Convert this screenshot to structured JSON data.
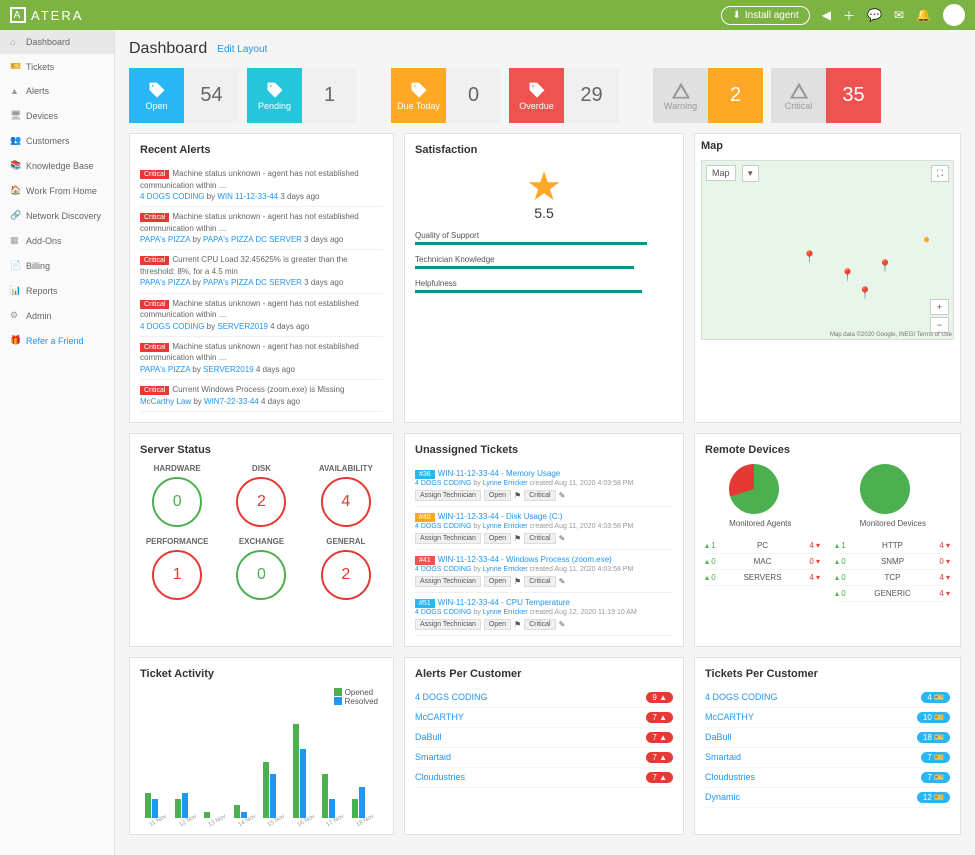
{
  "brand": "ATERA",
  "install_label": "Install agent",
  "nav": [
    {
      "icon": "⌂",
      "label": "Dashboard",
      "active": true
    },
    {
      "icon": "🎫",
      "label": "Tickets"
    },
    {
      "icon": "▲",
      "label": "Alerts"
    },
    {
      "icon": "🖥",
      "label": "Devices"
    },
    {
      "icon": "👥",
      "label": "Customers"
    },
    {
      "icon": "📚",
      "label": "Knowledge Base"
    },
    {
      "icon": "🏠",
      "label": "Work From Home"
    },
    {
      "icon": "🔗",
      "label": "Network Discovery"
    },
    {
      "icon": "▦",
      "label": "Add-Ons"
    },
    {
      "icon": "📄",
      "label": "Billing"
    },
    {
      "icon": "📊",
      "label": "Reports"
    },
    {
      "icon": "⚙",
      "label": "Admin"
    }
  ],
  "refer_label": "Refer a Friend",
  "page_title": "Dashboard",
  "edit_layout": "Edit Layout",
  "stats": [
    {
      "label": "Open",
      "value": "54",
      "color": "c-blue"
    },
    {
      "label": "Pending",
      "value": "1",
      "color": "c-cyan"
    },
    {
      "label": "Due Today",
      "value": "0",
      "color": "c-orange"
    },
    {
      "label": "Overdue",
      "value": "29",
      "color": "c-red"
    },
    {
      "label": "Warning",
      "value": "2",
      "color": "c-orange",
      "icon": "warn",
      "iconbg": "c-gray"
    },
    {
      "label": "Critical",
      "value": "35",
      "color": "c-red",
      "icon": "warn",
      "iconbg": "c-gray"
    }
  ],
  "recent_alerts": {
    "title": "Recent Alerts",
    "items": [
      {
        "sev": "Critical",
        "msg": "Machine status unknown - agent has not established communication within …",
        "cust": "4 DOGS CODING",
        "dev": "WIN 11-12-33-44",
        "age": "3 days ago"
      },
      {
        "sev": "Critical",
        "msg": "Machine status unknown - agent has not established communication within …",
        "cust": "PAPA's PIZZA",
        "dev": "PAPA's PIZZA DC SERVER",
        "age": "3 days ago"
      },
      {
        "sev": "Critical",
        "msg": "Current CPU Load 32.45625% is greater than the threshold: 8%, for a 4.5 min",
        "cust": "PAPA's PIZZA",
        "dev": "PAPA's PIZZA DC SERVER",
        "age": "3 days ago"
      },
      {
        "sev": "Critical",
        "msg": "Machine status unknown - agent has not established communication within …",
        "cust": "4 DOGS CODING",
        "dev": "SERVER2019",
        "age": "4 days ago"
      },
      {
        "sev": "Critical",
        "msg": "Machine status unknown - agent has not established communication within …",
        "cust": "PAPA's PIZZA",
        "dev": "SERVER2019",
        "age": "4 days ago"
      },
      {
        "sev": "Critical",
        "msg": "Current Windows Process (zoom.exe) is Missing",
        "cust": "McCarthy Law",
        "dev": "WIN7-22-33-44",
        "age": "4 days ago"
      }
    ]
  },
  "satisfaction": {
    "title": "Satisfaction",
    "score": "5.5",
    "metrics": [
      {
        "label": "Quality of Support",
        "pct": 90
      },
      {
        "label": "Technician Knowledge",
        "pct": 85
      },
      {
        "label": "Helpfulness",
        "pct": 88
      }
    ]
  },
  "map": {
    "title": "Map",
    "type_label": "Map",
    "attrib": "Map data ©2020 Google, INEGI    Terms of Use"
  },
  "server_status": {
    "title": "Server Status",
    "items": [
      {
        "label": "HARDWARE",
        "val": "0",
        "cls": "g-green"
      },
      {
        "label": "DISK",
        "val": "2",
        "cls": "g-red"
      },
      {
        "label": "AVAILABILITY",
        "val": "4",
        "cls": "g-red"
      },
      {
        "label": "PERFORMANCE",
        "val": "1",
        "cls": "g-red"
      },
      {
        "label": "EXCHANGE",
        "val": "0",
        "cls": "g-green"
      },
      {
        "label": "GENERAL",
        "val": "2",
        "cls": "g-red"
      }
    ]
  },
  "unassigned": {
    "title": "Unassigned Tickets",
    "items": [
      {
        "id": "#36",
        "title": "WIN-11-12-33-44 - Memory Usage",
        "cust": "4 DOGS CODING",
        "by": "Lynne Erricker",
        "created": "created Aug 11, 2020 4:03:58 PM",
        "cls": "b"
      },
      {
        "id": "#40",
        "title": "WIN-11-12-33-44 - Disk Usage (C:)",
        "cust": "4 DOGS CODING",
        "by": "Lynne Erricker",
        "created": "created Aug 11, 2020 4:03:58 PM",
        "cls": "o"
      },
      {
        "id": "#41",
        "title": "WIN-11-12-33-44 - Windows Process (zoom.exe)",
        "cust": "4 DOGS CODING",
        "by": "Lynne Erricker",
        "created": "created Aug 11, 2020 4:03:58 PM",
        "cls": "r"
      },
      {
        "id": "#51",
        "title": "WIN-11-12-33-44 - CPU Temperature",
        "cust": "4 DOGS CODING",
        "by": "Lynne Erricker",
        "created": "created Aug 12, 2020 11:19:10 AM",
        "cls": "b"
      }
    ],
    "assign_label": "Assign Technician",
    "open_label": "Open",
    "crit_label": "Critical"
  },
  "remote_devices": {
    "title": "Remote Devices",
    "agents_label": "Monitored Agents",
    "devices_label": "Monitored Devices",
    "agents": [
      {
        "name": "PC",
        "up": "1",
        "dn": "4"
      },
      {
        "name": "MAC",
        "up": "0",
        "dn": "0"
      },
      {
        "name": "SERVERS",
        "up": "0",
        "dn": "4"
      }
    ],
    "devices": [
      {
        "name": "HTTP",
        "up": "1",
        "dn": "4"
      },
      {
        "name": "SNMP",
        "up": "0",
        "dn": "0"
      },
      {
        "name": "TCP",
        "up": "0",
        "dn": "4"
      },
      {
        "name": "GENERIC",
        "up": "0",
        "dn": "4"
      }
    ]
  },
  "ticket_activity": {
    "title": "Ticket Activity",
    "legend": {
      "opened": "Opened",
      "resolved": "Resolved"
    }
  },
  "chart_data": {
    "type": "bar",
    "categories": [
      "11 Nov",
      "12 Nov",
      "13 Nov",
      "14 Nov",
      "15 Nov",
      "16 Nov",
      "17 Nov",
      "18 Nov"
    ],
    "series": [
      {
        "name": "Opened",
        "values": [
          4,
          3,
          1,
          2,
          9,
          15,
          7,
          3
        ]
      },
      {
        "name": "Resolved",
        "values": [
          3,
          4,
          0,
          1,
          7,
          11,
          3,
          5
        ]
      }
    ],
    "ylim": [
      0,
      16
    ]
  },
  "alerts_per_customer": {
    "title": "Alerts Per Customer",
    "items": [
      {
        "name": "4 DOGS CODING",
        "val": "9"
      },
      {
        "name": "McCARTHY",
        "val": "7"
      },
      {
        "name": "DaBull",
        "val": "7"
      },
      {
        "name": "Smartaid",
        "val": "7"
      },
      {
        "name": "Cloudustries",
        "val": "7"
      }
    ]
  },
  "tickets_per_customer": {
    "title": "Tickets Per Customer",
    "items": [
      {
        "name": "4 DOGS CODING",
        "val": "4"
      },
      {
        "name": "McCARTHY",
        "val": "10"
      },
      {
        "name": "DaBull",
        "val": "18"
      },
      {
        "name": "Smartaid",
        "val": "7"
      },
      {
        "name": "Cloudustries",
        "val": "7"
      },
      {
        "name": "Dynamic",
        "val": "12"
      }
    ]
  }
}
